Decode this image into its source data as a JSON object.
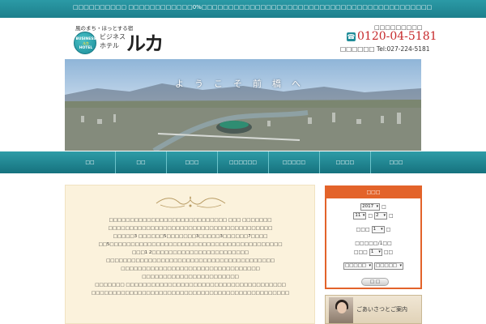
{
  "topbar": {
    "text": "□□□□□□□□□□ □□□□□□□□□□□□0%□□□□□□□□□□□□□□□□□□□□□□□□□□□□□□□□□□□□□□□□□□□"
  },
  "header": {
    "tagline": "風のまち・ほっとする宿",
    "badge_line1": "BUSINESS",
    "badge_line2": "ルカ",
    "badge_line3": "HOTEL",
    "logo_small": "ビジネス ホテル",
    "logo_big": "ルカ",
    "reservation_label": "□□□□□□□□□",
    "freedial": "0120-04-5181",
    "tel_label": "□□□□□□",
    "tel": "Tel:027-224-5181"
  },
  "hero": {
    "title": "ようこそ前橋へ"
  },
  "nav": {
    "items": [
      "□□",
      "□□",
      "□□□",
      "□□□□□□",
      "□□□□□",
      "□□□□",
      "□□□"
    ]
  },
  "welcome": {
    "lines": [
      "□□□□□□□□□□□□□□□□□□□□□□□□□□□□ □□□ □□□□□□□",
      "□□□□□□□□□□□□□□□□□□□□□□□□□□□□□□□□□□□□□□□",
      "□□□□□3 □□□□□□5□□□□□□□3□□□□□3□□□□□□7□□□□",
      "□□5□□□□□□□□□□□□□□□□□□□□□□□□□□□□□□□□□□□□□□□□□",
      "□□□1 2□□□□□□□□□□□□□□□□□□□□□□□",
      "□□□□□□□□□□□□□□□□□□□□□□□□□□□□□□□□□□□□□□□□",
      "□□□□□□□□□□□□□□□□□□□□□□□□□□□□□□□□□",
      "□□□□□□□□□□□□□□□□□□□□□□□",
      "□□□□□□□ □□□□□□□□□□□□□□□□□□□□□□□□□□□□□□□□□□□□□□",
      "□□□□□□□□□□□□□□□□□□□□□□□□□□□□□□□□□□□□□□□□□□□□□□□"
    ]
  },
  "booking": {
    "title": "□□□",
    "year_value": "2017",
    "year_suffix": "□",
    "month_value": "11",
    "month_suffix": "□",
    "day_value": "2",
    "day_suffix": "□",
    "nights_label": "□□□",
    "nights_value": "1",
    "nights_suffix": "□",
    "rooms_label": "□□□□□/1□□",
    "rooms_prefix": "□□□",
    "rooms_value": "1",
    "rooms_suffix": "□□",
    "room_type_value": "□□□□□",
    "plan_value": "□□□□□",
    "search_label": "□ □"
  },
  "greeting": {
    "text": "ごあいさつとご案内"
  }
}
